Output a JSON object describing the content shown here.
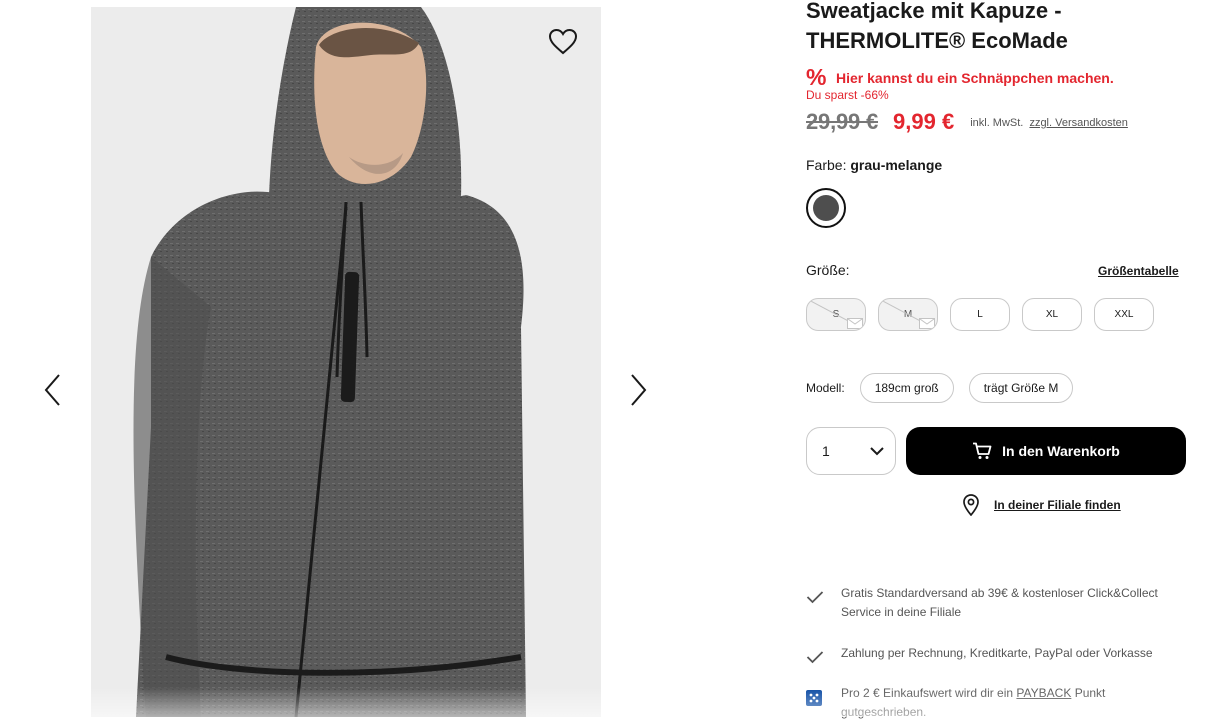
{
  "product": {
    "title_line1": "Sweatjacke mit Kapuze -",
    "title_line2": "THERMOLITE® EcoMade",
    "deal_icon": "%",
    "deal_text": "Hier kannst du ein Schnäppchen machen.",
    "savings_text": "Du sparst -66%",
    "old_price": "29,99 €",
    "new_price": "9,99 €",
    "tax_note": "inkl. MwSt.",
    "shipping_link": "zzgl. Versandkosten",
    "accent_color": "#e3262f"
  },
  "color": {
    "label": "Farbe:",
    "value": "grau-melange",
    "swatch_color": "#4e4e4e"
  },
  "size": {
    "label": "Größe:",
    "chart_link": "Größentabelle",
    "options": [
      {
        "label": "S",
        "available": false
      },
      {
        "label": "M",
        "available": false
      },
      {
        "label": "L",
        "available": true
      },
      {
        "label": "XL",
        "available": true
      },
      {
        "label": "XXL",
        "available": true
      }
    ]
  },
  "model": {
    "label": "Modell:",
    "height": "189cm groß",
    "wears": "trägt Größe M"
  },
  "cart": {
    "quantity": "1",
    "add_button": "In den Warenkorb"
  },
  "store": {
    "link": "In deiner Filiale finden"
  },
  "benefits": {
    "shipping": "Gratis Standardversand ab 39€ & kostenloser Click&Collect Service in deine Filiale",
    "payment": "Zahlung per Rechnung, Kreditkarte, PayPal oder Vorkasse",
    "payback_before": "Pro 2 € Einkaufswert wird dir ein",
    "payback_link": "PAYBACK",
    "payback_after": "Punkt gutgeschrieben."
  },
  "icons": {
    "wishlist": "heart-icon",
    "prev": "chevron-left-icon",
    "next": "chevron-right-icon",
    "cart": "cart-icon",
    "store": "location-pin-icon",
    "check": "checkmark-icon",
    "payback": "payback-icon"
  }
}
